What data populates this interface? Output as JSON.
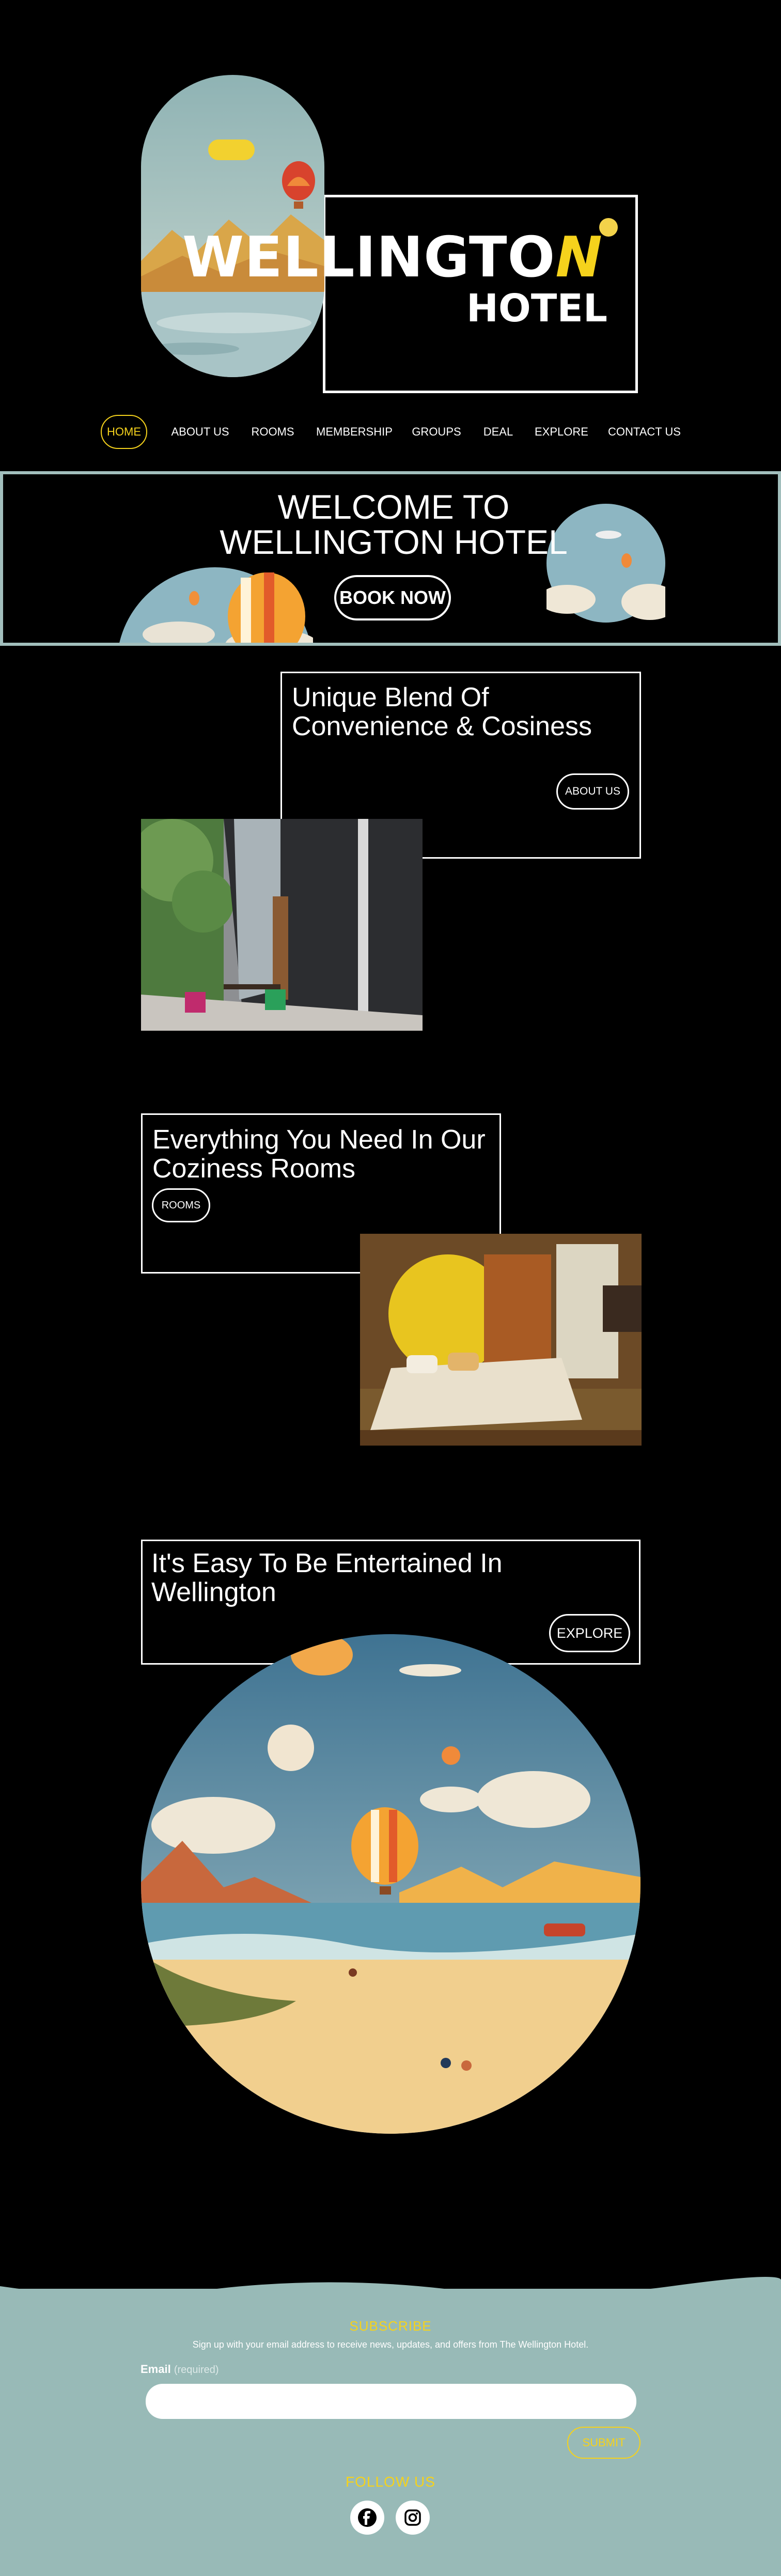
{
  "brand": {
    "logo_main_part1": "WELLINGTO",
    "logo_main_part2": "N",
    "logo_sub": "HOTEL",
    "accent_color": "#f5d21c"
  },
  "nav": {
    "items": [
      {
        "label": "HOME",
        "active": true
      },
      {
        "label": "ABOUT US"
      },
      {
        "label": "ROOMS"
      },
      {
        "label": "MEMBERSHIP"
      },
      {
        "label": "GROUPS"
      },
      {
        "label": "DEAL"
      },
      {
        "label": "EXPLORE"
      },
      {
        "label": "CONTACT US"
      }
    ]
  },
  "hero": {
    "title_line1": "WELCOME TO",
    "title_line2": "WELLINGTON HOTEL",
    "cta": "BOOK NOW",
    "border_color": "#a2bfbd"
  },
  "sections": [
    {
      "title": "Unique Blend Of Convenience & Cosiness",
      "button": "ABOUT US"
    },
    {
      "title": "Everything You Need In Our Coziness Rooms",
      "button": "ROOMS"
    },
    {
      "title": "It's Easy To Be Entertained In Wellington",
      "button": "EXPLORE"
    }
  ],
  "footer": {
    "background": "#98bab7",
    "subscribe_title": "SUBSCRIBE",
    "subscribe_text": "Sign up with your email address to receive news, updates, and offers from The Wellington Hotel.",
    "email_label": "Email",
    "email_required": "(required)",
    "submit": "SUBMIT",
    "follow_title": "FOLLOW US",
    "social": [
      {
        "icon": "facebook-icon"
      },
      {
        "icon": "instagram-icon"
      }
    ]
  }
}
